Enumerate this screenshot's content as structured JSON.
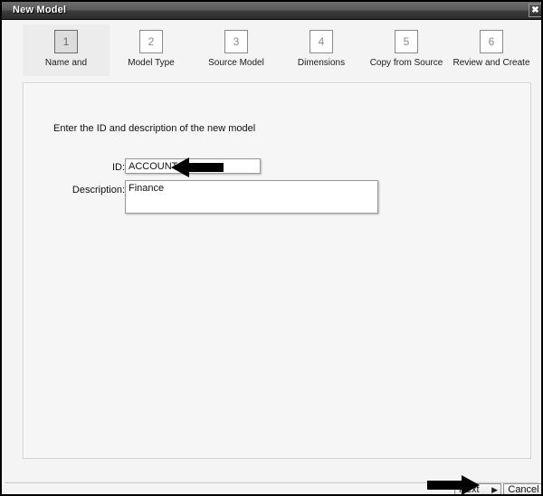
{
  "window": {
    "title": "New Model",
    "close_icon": "close-icon",
    "close_glyph": "✖"
  },
  "steps": [
    {
      "number": "1",
      "label": "Name and",
      "active": true
    },
    {
      "number": "2",
      "label": "Model Type",
      "active": false
    },
    {
      "number": "3",
      "label": "Source Model",
      "active": false
    },
    {
      "number": "4",
      "label": "Dimensions",
      "active": false
    },
    {
      "number": "5",
      "label": "Copy from Source",
      "active": false
    },
    {
      "number": "6",
      "label": "Review and Create",
      "active": false
    }
  ],
  "form": {
    "instruction": "Enter the ID and description of the new model",
    "id_label": "ID:",
    "id_value": "ACCOUNT",
    "id_placeholder": "",
    "description_label": "Description:",
    "description_value": "Finance",
    "description_placeholder": ""
  },
  "footer": {
    "next_label": "Next",
    "next_glyph": "▶",
    "cancel_label": "Cancel"
  },
  "annotations": [
    {
      "name": "arrow-pointing-to-id-field",
      "direction": "left"
    },
    {
      "name": "arrow-pointing-to-next-button",
      "direction": "right"
    }
  ],
  "colors": {
    "titlebar_dark": "#2b2b2b",
    "titlebar_light": "#6e6e6e",
    "dialog_background": "#f4f4f4",
    "panel_background": "#f6f6f6",
    "active_step_background": "#ececec",
    "annotation": "#000000"
  }
}
